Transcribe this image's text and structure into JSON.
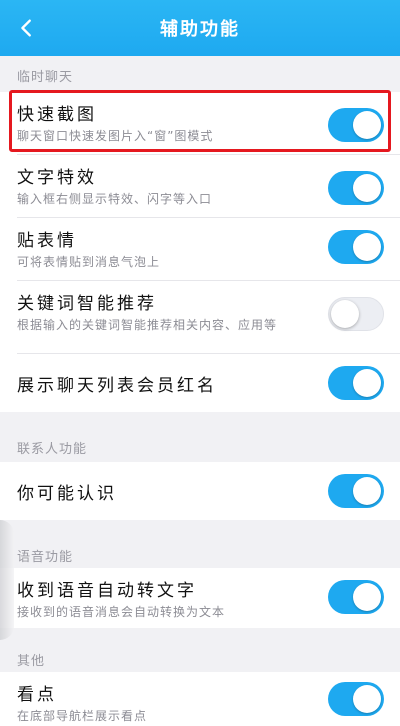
{
  "header": {
    "title": "辅助功能",
    "back_icon": "chevron-left-icon"
  },
  "colors": {
    "accent": "#1ea9f0",
    "highlight": "#e5181f"
  },
  "sections": {
    "chat": "临时聊天",
    "contacts": "联系人功能",
    "voice": "语音功能",
    "other": "其他"
  },
  "rows": {
    "quick_screenshot": {
      "title": "快速截图",
      "desc": "聊天窗口快速发图片入“窗”图模式",
      "on": true
    },
    "text_effects": {
      "title": "文字特效",
      "desc": "输入框右侧显示特效、闪字等入口",
      "on": true
    },
    "stickers": {
      "title": "贴表情",
      "desc": "可将表情贴到消息气泡上",
      "on": true
    },
    "keyword_recommend": {
      "title": "关键词智能推荐",
      "desc": "根据输入的关键词智能推荐相关内容、应用等",
      "on": false
    },
    "show_red_name": {
      "title": "展示聊天列表会员红名",
      "on": true
    },
    "may_know": {
      "title": "你可能认识",
      "on": true
    },
    "voice_to_text": {
      "title": "收到语音自动转文字",
      "desc": "接收到的语音消息会自动转换为文本",
      "on": true
    },
    "kandian": {
      "title": "看点",
      "desc": "在底部导航栏展示看点",
      "on": true
    }
  }
}
